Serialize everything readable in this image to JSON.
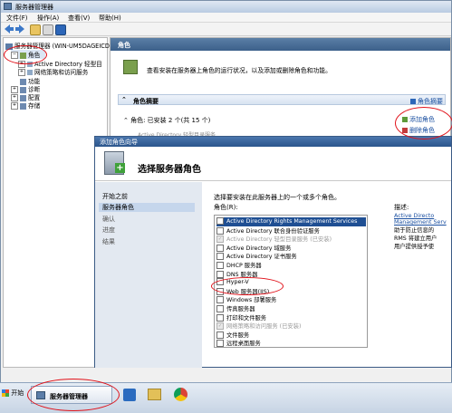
{
  "window": {
    "title": "服务器管理器"
  },
  "menu": [
    "文件(F)",
    "操作(A)",
    "查看(V)",
    "帮助(H)"
  ],
  "tree": {
    "root": "服务器管理器 (WIN-UM5DAGEICD",
    "items": [
      {
        "label": "角色",
        "expand": "−",
        "selected": true
      },
      {
        "label": "Active Directory 轻型目",
        "expand": "+"
      },
      {
        "label": "网络策略和访问服务",
        "expand": "+"
      },
      {
        "label": "功能",
        "expand": ""
      },
      {
        "label": "诊断",
        "expand": "+"
      },
      {
        "label": "配置",
        "expand": "+"
      },
      {
        "label": "存储",
        "expand": "+"
      }
    ]
  },
  "content": {
    "header": "角色",
    "description": "查看安装在服务器上角色的运行状况，以及添加或删除角色和功能。",
    "summary_title": "角色摘要",
    "summary_help": "角色摘要",
    "roles_line": "角色: 已安装 2 个(共 15 个)",
    "add_role": "添加角色",
    "remove_role": "删除角色",
    "partial_line": "Active Directory 轻型目录服务"
  },
  "dialog": {
    "title": "添加角色向导",
    "header_title": "选择服务器角色",
    "nav": [
      "开始之前",
      "服务器角色",
      "确认",
      "进度",
      "结果"
    ],
    "instruction": "选择要安装在此服务器上的一个或多个角色。",
    "roles_label": "角色(R):",
    "roles": [
      {
        "label": "Active Directory Rights Management Services",
        "state": "highlight"
      },
      {
        "label": "Active Directory 联合身份验证服务",
        "state": "normal"
      },
      {
        "label": "Active Directory 轻型目录服务   (已安装)",
        "state": "disabled"
      },
      {
        "label": "Active Directory 域服务",
        "state": "normal"
      },
      {
        "label": "Active Directory 证书服务",
        "state": "normal"
      },
      {
        "label": "DHCP 服务器",
        "state": "normal"
      },
      {
        "label": "DNS 服务器",
        "state": "normal"
      },
      {
        "label": "Hyper-V",
        "state": "normal"
      },
      {
        "label": "Web 服务器(IIS)",
        "state": "normal"
      },
      {
        "label": "Windows 部署服务",
        "state": "normal"
      },
      {
        "label": "传真服务器",
        "state": "normal"
      },
      {
        "label": "打印和文件服务",
        "state": "normal"
      },
      {
        "label": "网络策略和访问服务     (已安装)",
        "state": "disabled"
      },
      {
        "label": "文件服务",
        "state": "normal"
      },
      {
        "label": "远程桌面服务",
        "state": "normal"
      }
    ],
    "description_label": "描述:",
    "description_lines": [
      "Active Directo",
      "Management Serv",
      "助于防止信息的",
      "RMS 将建立用户",
      "用户提供授予使"
    ]
  },
  "taskbar": {
    "start": "开始",
    "app": "服务器管理器"
  },
  "colors": {
    "annotation": "#e1121a",
    "accent": "#2b558c"
  }
}
